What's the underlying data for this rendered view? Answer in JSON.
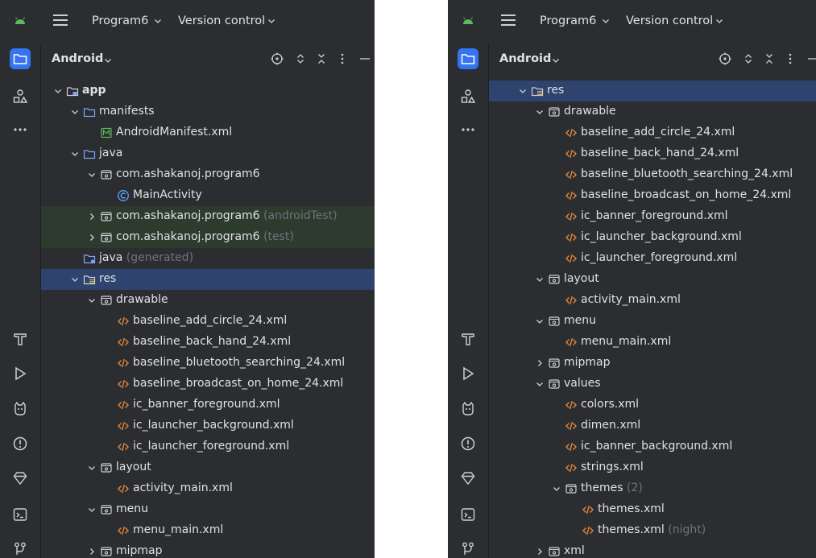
{
  "titlebar": {
    "project": "Program6",
    "vcs": "Version control"
  },
  "panel_header": {
    "view": "Android"
  },
  "colors": {
    "background": "#2b2d30",
    "selection": "#2e436e",
    "active_tool": "#3574f0",
    "xml_icon": "#e0883f",
    "folder_icon": "#7aa7ff",
    "manifest_icon": "#5fb85f",
    "class_icon": "#5da1ff",
    "test_tint": "#2d3a2e"
  },
  "left_panel": {
    "rows": [
      {
        "label": "app",
        "suffix": "",
        "indent": 0,
        "chevron": "down",
        "icon": "module-folder-icon",
        "bold": true
      },
      {
        "label": "manifests",
        "suffix": "",
        "indent": 1,
        "chevron": "down",
        "icon": "folder-icon"
      },
      {
        "label": "AndroidManifest.xml",
        "suffix": "",
        "indent": 2,
        "chevron": "none",
        "icon": "manifest-file-icon"
      },
      {
        "label": "java",
        "suffix": "",
        "indent": 1,
        "chevron": "down",
        "icon": "folder-icon"
      },
      {
        "label": "com.ashakanoj.program6",
        "suffix": "",
        "indent": 2,
        "chevron": "down",
        "icon": "package-icon"
      },
      {
        "label": "MainActivity",
        "suffix": "",
        "indent": 3,
        "chevron": "none",
        "icon": "class-icon"
      },
      {
        "label": "com.ashakanoj.program6",
        "suffix": " (androidTest)",
        "indent": 2,
        "chevron": "right",
        "icon": "package-icon",
        "tint": true
      },
      {
        "label": "com.ashakanoj.program6",
        "suffix": " (test)",
        "indent": 2,
        "chevron": "right",
        "icon": "package-icon",
        "tint": true
      },
      {
        "label": "java",
        "suffix": " (generated)",
        "indent": 1,
        "chevron": "none",
        "icon": "generated-folder-icon"
      },
      {
        "label": "res",
        "suffix": "",
        "indent": 1,
        "chevron": "down",
        "icon": "res-folder-icon",
        "selected": true
      },
      {
        "label": "drawable",
        "suffix": "",
        "indent": 2,
        "chevron": "down",
        "icon": "package-icon"
      },
      {
        "label": "baseline_add_circle_24.xml",
        "suffix": "",
        "indent": 3,
        "chevron": "none",
        "icon": "xml-file-icon"
      },
      {
        "label": "baseline_back_hand_24.xml",
        "suffix": "",
        "indent": 3,
        "chevron": "none",
        "icon": "xml-file-icon"
      },
      {
        "label": "baseline_bluetooth_searching_24.xml",
        "suffix": "",
        "indent": 3,
        "chevron": "none",
        "icon": "xml-file-icon"
      },
      {
        "label": "baseline_broadcast_on_home_24.xml",
        "suffix": "",
        "indent": 3,
        "chevron": "none",
        "icon": "xml-file-icon"
      },
      {
        "label": "ic_banner_foreground.xml",
        "suffix": "",
        "indent": 3,
        "chevron": "none",
        "icon": "xml-file-icon"
      },
      {
        "label": "ic_launcher_background.xml",
        "suffix": "",
        "indent": 3,
        "chevron": "none",
        "icon": "xml-file-icon"
      },
      {
        "label": "ic_launcher_foreground.xml",
        "suffix": "",
        "indent": 3,
        "chevron": "none",
        "icon": "xml-file-icon"
      },
      {
        "label": "layout",
        "suffix": "",
        "indent": 2,
        "chevron": "down",
        "icon": "package-icon"
      },
      {
        "label": "activity_main.xml",
        "suffix": "",
        "indent": 3,
        "chevron": "none",
        "icon": "xml-file-icon"
      },
      {
        "label": "menu",
        "suffix": "",
        "indent": 2,
        "chevron": "down",
        "icon": "package-icon"
      },
      {
        "label": "menu_main.xml",
        "suffix": "",
        "indent": 3,
        "chevron": "none",
        "icon": "xml-file-icon"
      },
      {
        "label": "mipmap",
        "suffix": "",
        "indent": 2,
        "chevron": "right",
        "icon": "package-icon"
      }
    ]
  },
  "right_panel": {
    "rows": [
      {
        "label": "res",
        "suffix": "",
        "indent": 1,
        "chevron": "down",
        "icon": "res-folder-icon",
        "selected": true
      },
      {
        "label": "drawable",
        "suffix": "",
        "indent": 2,
        "chevron": "down",
        "icon": "package-icon"
      },
      {
        "label": "baseline_add_circle_24.xml",
        "suffix": "",
        "indent": 3,
        "chevron": "none",
        "icon": "xml-file-icon"
      },
      {
        "label": "baseline_back_hand_24.xml",
        "suffix": "",
        "indent": 3,
        "chevron": "none",
        "icon": "xml-file-icon"
      },
      {
        "label": "baseline_bluetooth_searching_24.xml",
        "suffix": "",
        "indent": 3,
        "chevron": "none",
        "icon": "xml-file-icon"
      },
      {
        "label": "baseline_broadcast_on_home_24.xml",
        "suffix": "",
        "indent": 3,
        "chevron": "none",
        "icon": "xml-file-icon"
      },
      {
        "label": "ic_banner_foreground.xml",
        "suffix": "",
        "indent": 3,
        "chevron": "none",
        "icon": "xml-file-icon"
      },
      {
        "label": "ic_launcher_background.xml",
        "suffix": "",
        "indent": 3,
        "chevron": "none",
        "icon": "xml-file-icon"
      },
      {
        "label": "ic_launcher_foreground.xml",
        "suffix": "",
        "indent": 3,
        "chevron": "none",
        "icon": "xml-file-icon"
      },
      {
        "label": "layout",
        "suffix": "",
        "indent": 2,
        "chevron": "down",
        "icon": "package-icon"
      },
      {
        "label": "activity_main.xml",
        "suffix": "",
        "indent": 3,
        "chevron": "none",
        "icon": "xml-file-icon"
      },
      {
        "label": "menu",
        "suffix": "",
        "indent": 2,
        "chevron": "down",
        "icon": "package-icon"
      },
      {
        "label": "menu_main.xml",
        "suffix": "",
        "indent": 3,
        "chevron": "none",
        "icon": "xml-file-icon"
      },
      {
        "label": "mipmap",
        "suffix": "",
        "indent": 2,
        "chevron": "right",
        "icon": "package-icon"
      },
      {
        "label": "values",
        "suffix": "",
        "indent": 2,
        "chevron": "down",
        "icon": "package-icon"
      },
      {
        "label": "colors.xml",
        "suffix": "",
        "indent": 3,
        "chevron": "none",
        "icon": "xml-file-icon"
      },
      {
        "label": "dimen.xml",
        "suffix": "",
        "indent": 3,
        "chevron": "none",
        "icon": "xml-file-icon"
      },
      {
        "label": "ic_banner_background.xml",
        "suffix": "",
        "indent": 3,
        "chevron": "none",
        "icon": "xml-file-icon"
      },
      {
        "label": "strings.xml",
        "suffix": "",
        "indent": 3,
        "chevron": "none",
        "icon": "xml-file-icon"
      },
      {
        "label": "themes",
        "suffix": " (2)",
        "indent": 3,
        "chevron": "down",
        "icon": "package-icon"
      },
      {
        "label": "themes.xml",
        "suffix": "",
        "indent": 4,
        "chevron": "none",
        "icon": "xml-file-icon"
      },
      {
        "label": "themes.xml",
        "suffix": " (night)",
        "indent": 4,
        "chevron": "none",
        "icon": "xml-file-icon"
      },
      {
        "label": "xml",
        "suffix": "",
        "indent": 2,
        "chevron": "right",
        "icon": "package-icon"
      }
    ]
  }
}
